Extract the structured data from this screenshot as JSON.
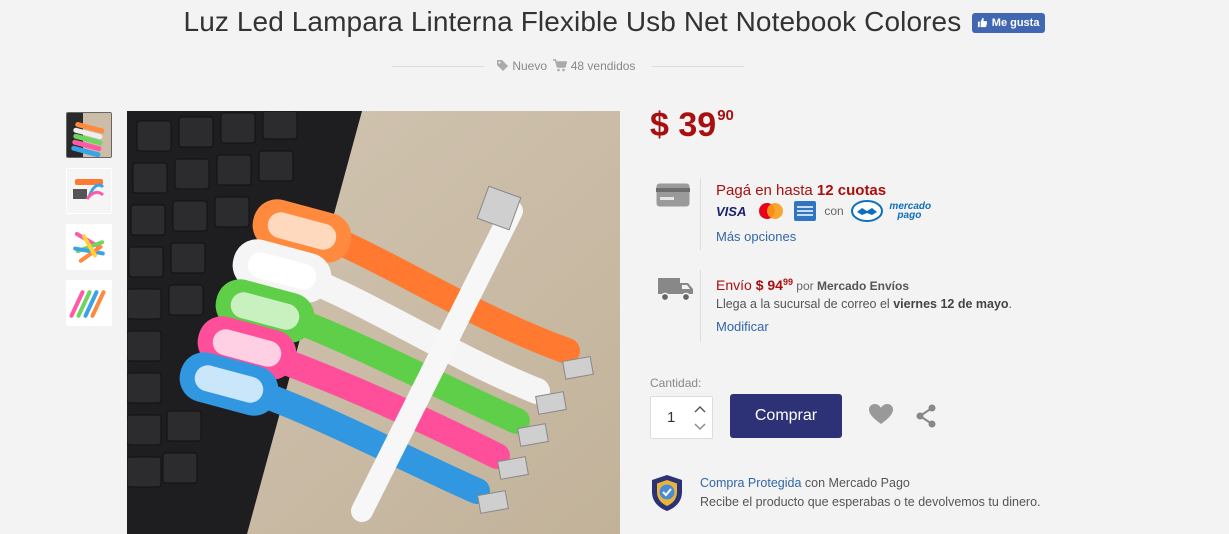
{
  "header": {
    "title": "Luz Led Lampara Linterna Flexible Usb Net Notebook Colores",
    "like_label": "Me gusta"
  },
  "meta": {
    "condition": "Nuevo",
    "sold": "48 vendidos"
  },
  "thumbnails": [
    {
      "icon": "product-thumbnail-1",
      "active": true
    },
    {
      "icon": "product-thumbnail-2",
      "active": false
    },
    {
      "icon": "product-thumbnail-3",
      "active": false
    },
    {
      "icon": "product-thumbnail-4",
      "active": false
    }
  ],
  "price": {
    "currency": "$",
    "integer": "39",
    "cents": "90"
  },
  "payment": {
    "prefix": "Pagá en hasta ",
    "installments": "12 cuotas",
    "visa": "VISA",
    "mastercard": "MasterCard",
    "con": "con",
    "mp_line1": "mercado",
    "mp_line2": "pago",
    "more_options": "Más opciones"
  },
  "shipping": {
    "label": "Envío ",
    "amount": "$ 94",
    "cents": "99",
    "by_prefix": " por ",
    "by_name": "Mercado Envíos",
    "delivery_prefix": "Llega a la sucursal de correo el ",
    "delivery_date": "viernes 12 de mayo",
    "delivery_suffix": ".",
    "modify": "Modificar"
  },
  "purchase": {
    "quantity_label": "Cantidad:",
    "quantity": "1",
    "buy_label": "Comprar"
  },
  "protection": {
    "link": "Compra Protegida",
    "suffix": " con Mercado Pago",
    "description": "Recibe el producto que esperabas o te devolvemos tu dinero."
  },
  "colors": {
    "price_red": "#a90f0f",
    "primary_button": "#2d3277",
    "link_blue": "#3166a8",
    "facebook_blue": "#4267b2"
  }
}
